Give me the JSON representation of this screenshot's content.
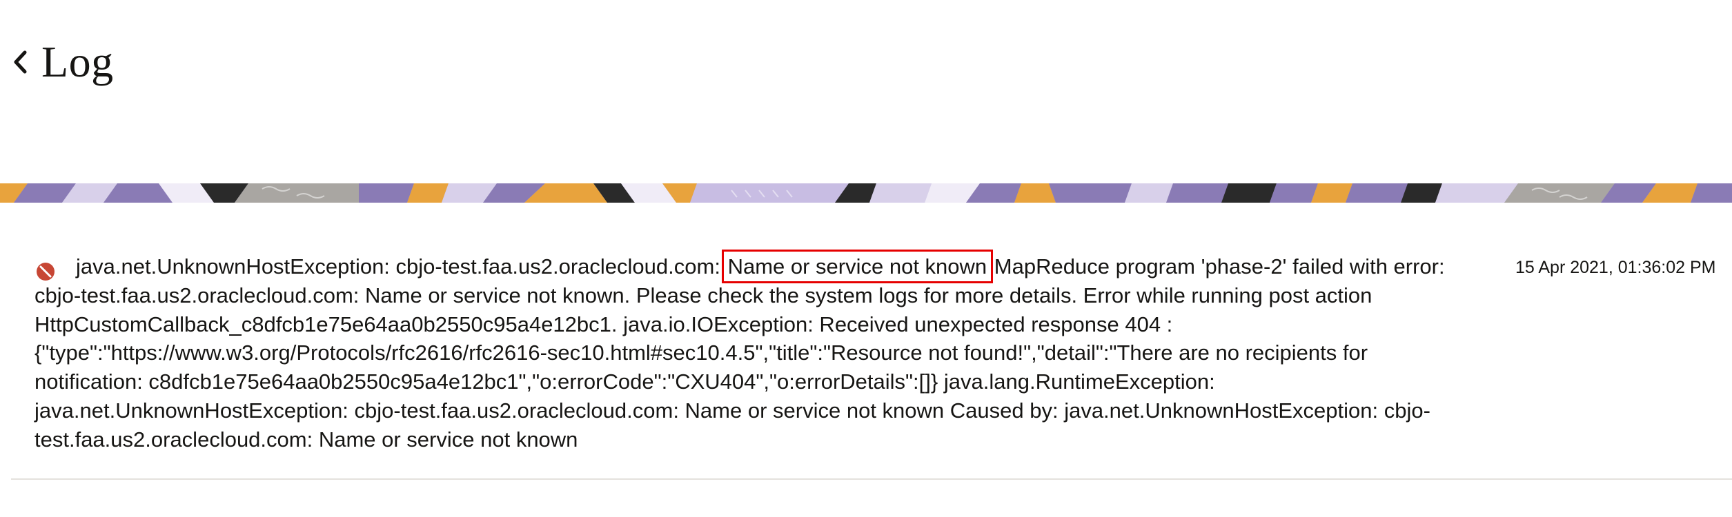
{
  "header": {
    "back_icon": "chevron-left-icon",
    "title": "Log"
  },
  "log_entry": {
    "status_icon": "error-icon",
    "message_before": "java.net.UnknownHostException: cbjo-test.faa.us2.oraclecloud.com:",
    "message_highlight": "Name or service not known",
    "message_after": "MapReduce program 'phase-2' failed with error: cbjo-test.faa.us2.oraclecloud.com: Name or service not known. Please check the system logs for more details. Error while running post action HttpCustomCallback_c8dfcb1e75e64aa0b2550c95a4e12bc1. java.io.IOException: Received unexpected response 404 : {\"type\":\"https://www.w3.org/Protocols/rfc2616/rfc2616-sec10.html#sec10.4.5\",\"title\":\"Resource not found!\",\"detail\":\"There are no recipients for notification: c8dfcb1e75e64aa0b2550c95a4e12bc1\",\"o:errorCode\":\"CXU404\",\"o:errorDetails\":[]} java.lang.RuntimeException: java.net.UnknownHostException: cbjo-test.faa.us2.oraclecloud.com: Name or service not known Caused by: java.net.UnknownHostException: cbjo-test.faa.us2.oraclecloud.com: Name or service not known",
    "timestamp": "15 Apr 2021, 01:36:02 PM"
  },
  "colors": {
    "error_red": "#c74634",
    "highlight_border": "#e60000",
    "divider": "#e4e1dd",
    "banner_purple": "#8a7bb5",
    "banner_orange": "#e8a33d"
  }
}
